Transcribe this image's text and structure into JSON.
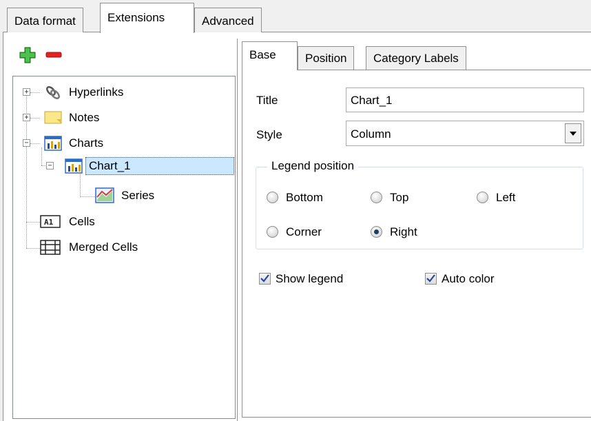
{
  "top_tabs": [
    {
      "label": "Data format"
    },
    {
      "label": "Extensions"
    },
    {
      "label": "Advanced"
    }
  ],
  "toolbar": {
    "add_icon": "plus-icon",
    "remove_icon": "minus-icon"
  },
  "tree": {
    "items": [
      {
        "label": "Hyperlinks",
        "icon": "hyperlink-icon"
      },
      {
        "label": "Notes",
        "icon": "note-icon"
      },
      {
        "label": "Charts",
        "icon": "chart-icon"
      },
      {
        "label": "Chart_1",
        "icon": "chart-icon"
      },
      {
        "label": "Series",
        "icon": "series-icon"
      },
      {
        "label": "Cells",
        "icon": "cell-icon"
      },
      {
        "label": "Merged Cells",
        "icon": "merged-cells-icon"
      }
    ]
  },
  "sub_tabs": [
    {
      "label": "Base"
    },
    {
      "label": "Position"
    },
    {
      "label": "Category Labels"
    }
  ],
  "form": {
    "title_label": "Title",
    "title_value": "Chart_1",
    "style_label": "Style",
    "style_value": "Column"
  },
  "legend_position": {
    "title": "Legend position",
    "options": [
      {
        "label": "Bottom",
        "selected": false
      },
      {
        "label": "Top",
        "selected": false
      },
      {
        "label": "Left",
        "selected": false
      },
      {
        "label": "Corner",
        "selected": false
      },
      {
        "label": "Right",
        "selected": true
      }
    ]
  },
  "checkboxes": {
    "show_legend": {
      "label": "Show legend",
      "checked": true
    },
    "auto_color": {
      "label": "Auto color",
      "checked": true
    }
  },
  "colors": {
    "selection": "#cce8ff",
    "accent": "#2e6bc6"
  }
}
